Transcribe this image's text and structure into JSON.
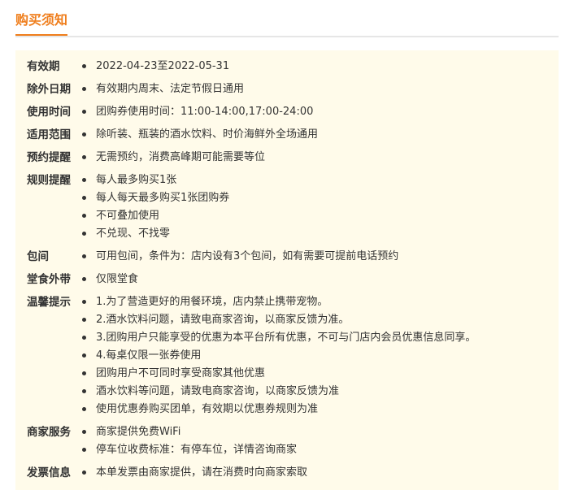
{
  "header": {
    "title": "购买须知"
  },
  "sections": [
    {
      "label": "有效期",
      "items": [
        "2022-04-23至2022-05-31"
      ]
    },
    {
      "label": "除外日期",
      "items": [
        "有效期内周末、法定节假日通用"
      ]
    },
    {
      "label": "使用时间",
      "items": [
        "团购券使用时间：11:00-14:00,17:00-24:00"
      ]
    },
    {
      "label": "适用范围",
      "items": [
        "除听装、瓶装的酒水饮料、时价海鲜外全场通用"
      ]
    },
    {
      "label": "预约提醒",
      "items": [
        "无需预约，消费高峰期可能需要等位"
      ]
    },
    {
      "label": "规则提醒",
      "items": [
        "每人最多购买1张",
        "每人每天最多购买1张团购券",
        "不可叠加使用",
        "不兑现、不找零"
      ]
    },
    {
      "label": "包间",
      "items": [
        "可用包间，条件为：店内设有3个包间，如有需要可提前电话预约"
      ]
    },
    {
      "label": "堂食外带",
      "items": [
        "仅限堂食"
      ]
    },
    {
      "label": "温馨提示",
      "items": [
        "1.为了营造更好的用餐环境，店内禁止携带宠物。",
        "2.酒水饮料问题，请致电商家咨询，以商家反馈为准。",
        "3.团购用户只能享受的优惠为本平台所有优惠，不可与门店内会员优惠信息同享。",
        "4.每桌仅限一张券使用",
        "团购用户不可同时享受商家其他优惠",
        "酒水饮料等问题，请致电商家咨询，以商家反馈为准",
        "使用优惠券购买团单，有效期以优惠券规则为准"
      ]
    },
    {
      "label": "商家服务",
      "items": [
        "商家提供免费WiFi",
        "停车位收费标准：有停车位，详情咨询商家"
      ]
    },
    {
      "label": "发票信息",
      "items": [
        "本单发票由商家提供，请在消费时向商家索取"
      ]
    }
  ]
}
